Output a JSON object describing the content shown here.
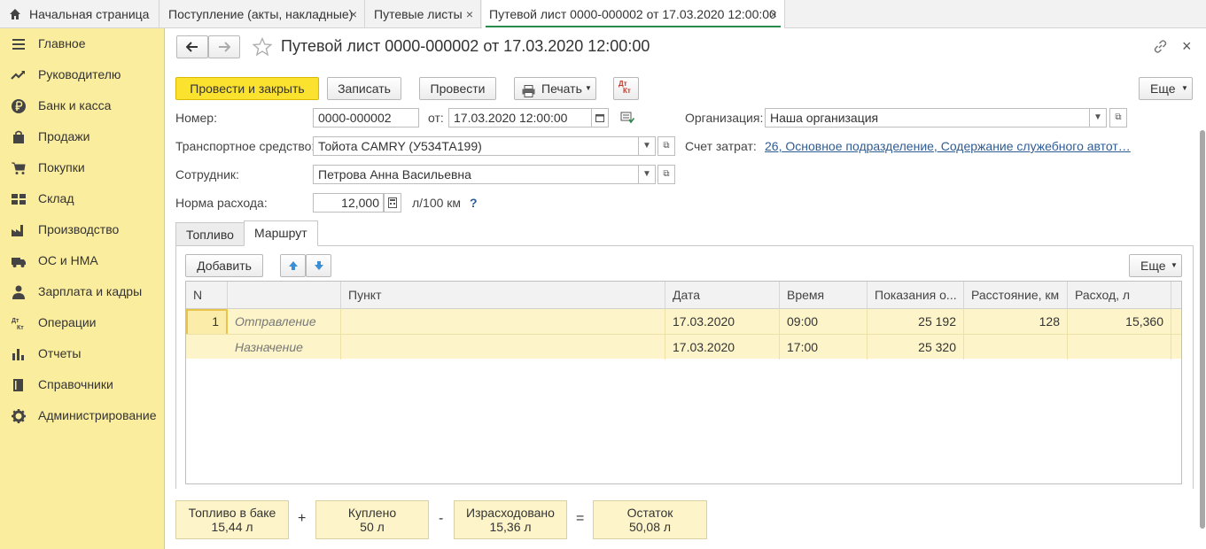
{
  "tabs": [
    {
      "label": "Начальная страница",
      "closable": false
    },
    {
      "label": "Поступление (акты, накладные)",
      "closable": true
    },
    {
      "label": "Путевые листы",
      "closable": true
    },
    {
      "label": "Путевой лист 0000-000002 от 17.03.2020 12:00:00",
      "closable": true,
      "active": true
    }
  ],
  "tab_close_glyph": "×",
  "sidebar": {
    "items": [
      {
        "label": "Главное",
        "icon": "menu-icon"
      },
      {
        "label": "Руководителю",
        "icon": "trend-icon"
      },
      {
        "label": "Банк и касса",
        "icon": "ruble-icon"
      },
      {
        "label": "Продажи",
        "icon": "bag-icon"
      },
      {
        "label": "Покупки",
        "icon": "cart-icon"
      },
      {
        "label": "Склад",
        "icon": "warehouse-icon"
      },
      {
        "label": "Производство",
        "icon": "factory-icon"
      },
      {
        "label": "ОС и НМА",
        "icon": "truck-icon"
      },
      {
        "label": "Зарплата и кадры",
        "icon": "person-icon"
      },
      {
        "label": "Операции",
        "icon": "dt-kt-icon"
      },
      {
        "label": "Отчеты",
        "icon": "bar-chart-icon"
      },
      {
        "label": "Справочники",
        "icon": "book-icon"
      },
      {
        "label": "Администрирование",
        "icon": "gear-icon"
      }
    ]
  },
  "header": {
    "title": "Путевой лист 0000-000002 от 17.03.2020 12:00:00"
  },
  "toolbar": {
    "post_close": "Провести и закрыть",
    "save": "Записать",
    "post": "Провести",
    "print": "Печать",
    "more": "Еще",
    "dtkt_top": "Дт",
    "dtkt_bottom": "Кт"
  },
  "form": {
    "number_label": "Номер:",
    "number_value": "0000-000002",
    "date_label": "от:",
    "date_value": "17.03.2020 12:00:00",
    "org_label": "Организация:",
    "org_value": "Наша организация",
    "vehicle_label": "Транспортное средство:",
    "vehicle_value": "Тойота CAMRY (У534ТА199)",
    "cost_account_label": "Счет затрат:",
    "cost_account_value": "26, Основное подразделение, Содержание служебного автот…",
    "employee_label": "Сотрудник:",
    "employee_value": "Петрова Анна Васильевна",
    "norm_label": "Норма расхода:",
    "norm_value": "12,000",
    "norm_unit": "л/100 км",
    "help": "?"
  },
  "form_tabs": [
    {
      "label": "Топливо",
      "active": false
    },
    {
      "label": "Маршрут",
      "active": true
    }
  ],
  "route": {
    "add": "Добавить",
    "more": "Еще",
    "columns": [
      "N",
      "",
      "Пункт",
      "Дата",
      "Время",
      "Показания о...",
      "Расстояние, км",
      "Расход, л"
    ],
    "rows": [
      {
        "n": "1",
        "type": "Отправление",
        "point": "",
        "date": "17.03.2020",
        "time": "09:00",
        "odometer": "25 192",
        "distance": "128",
        "consumption": "15,360"
      },
      {
        "n": "",
        "type": "Назначение",
        "point": "",
        "date": "17.03.2020",
        "time": "17:00",
        "odometer": "25 320",
        "distance": "",
        "consumption": ""
      }
    ]
  },
  "summary": {
    "in_tank_label": "Топливо в баке",
    "in_tank_value": "15,44 л",
    "plus": "+",
    "bought_label": "Куплено",
    "bought_value": "50 л",
    "minus": "-",
    "spent_label": "Израсходовано",
    "spent_value": "15,36 л",
    "equals": "=",
    "rest_label": "Остаток",
    "rest_value": "50,08 л"
  },
  "colors": {
    "sidebar_bg": "#fbed9e",
    "primary_button": "#fbe22f",
    "row_highlight": "#fdf5c9",
    "link": "#2e5c94",
    "active_tab_underline": "#2a8a4a"
  }
}
